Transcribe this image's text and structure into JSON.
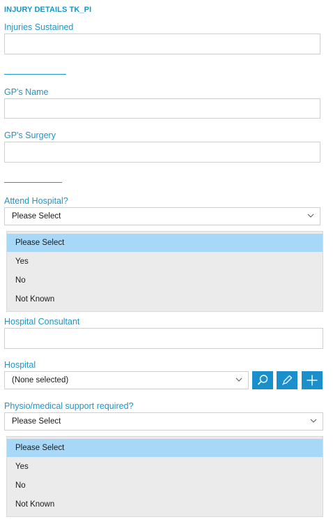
{
  "section": {
    "title": "INJURY DETAILS TK_PI"
  },
  "injuries": {
    "label": "Injuries Sustained",
    "value": ""
  },
  "gp_name": {
    "label": "GP's Name",
    "value": ""
  },
  "gp_surgery": {
    "label": "GP's Surgery",
    "value": ""
  },
  "attend_hospital": {
    "label": "Attend Hospital?",
    "selected": "Please Select",
    "options": [
      "Please Select",
      "Yes",
      "No",
      "Not Known"
    ]
  },
  "hospital_consultant": {
    "label": "Hospital Consultant",
    "value": ""
  },
  "hospital": {
    "label": "Hospital",
    "selected": "(None selected)",
    "buttons": [
      "search-icon",
      "pencil-icon",
      "plus-icon"
    ]
  },
  "physio": {
    "label": "Physio/medical support required?",
    "selected": "Please Select",
    "options": [
      "Please Select",
      "Yes",
      "No",
      "Not Known"
    ]
  },
  "colors": {
    "accent": "#1f94c8",
    "button": "#1b8fcc",
    "highlight": "#a8d8f8",
    "dropdown_bg": "#ebebeb"
  }
}
